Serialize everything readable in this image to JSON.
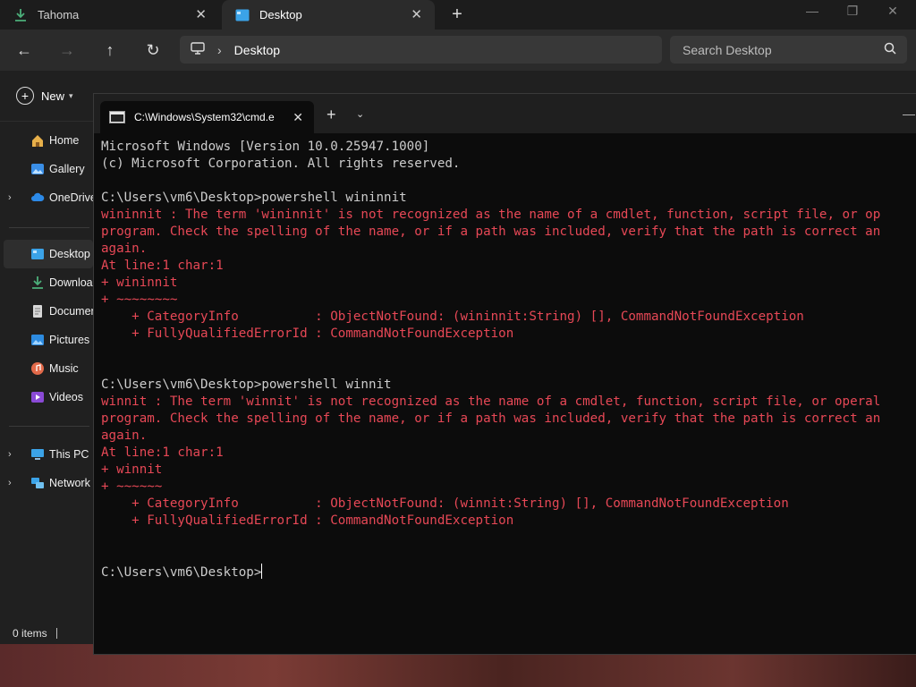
{
  "explorer": {
    "tabs": [
      {
        "label": "Tahoma",
        "icon": "download-icon",
        "active": false
      },
      {
        "label": "Desktop",
        "icon": "desktop-folder-icon",
        "active": true
      }
    ],
    "address": {
      "location": "Desktop"
    },
    "search": {
      "placeholder": "Search Desktop"
    },
    "command_bar": {
      "new_label": "New"
    },
    "sidebar": {
      "items": [
        {
          "label": "Home",
          "icon": "home-icon"
        },
        {
          "label": "Gallery",
          "icon": "gallery-icon"
        },
        {
          "label": "OneDrive",
          "icon": "cloud-icon"
        },
        {
          "label": "Desktop",
          "icon": "desktop-folder-icon"
        },
        {
          "label": "Downloads",
          "icon": "download-icon"
        },
        {
          "label": "Documents",
          "icon": "document-icon"
        },
        {
          "label": "Pictures",
          "icon": "pictures-icon"
        },
        {
          "label": "Music",
          "icon": "music-icon"
        },
        {
          "label": "Videos",
          "icon": "video-icon"
        },
        {
          "label": "This PC",
          "icon": "computer-icon"
        },
        {
          "label": "Network",
          "icon": "network-icon"
        }
      ]
    },
    "status": {
      "items_count": "0 items"
    }
  },
  "terminal": {
    "tab_title": "C:\\Windows\\System32\\cmd.e",
    "lines": [
      {
        "t": "Microsoft Windows [Version 10.0.25947.1000]",
        "c": "w"
      },
      {
        "t": "(c) Microsoft Corporation. All rights reserved.",
        "c": "w"
      },
      {
        "t": "",
        "c": "w"
      },
      {
        "t": "C:\\Users\\vm6\\Desktop>powershell wininnit",
        "c": "w"
      },
      {
        "t": "wininnit : The term 'wininnit' is not recognized as the name of a cmdlet, function, script file, or op",
        "c": "e"
      },
      {
        "t": "program. Check the spelling of the name, or if a path was included, verify that the path is correct an",
        "c": "e"
      },
      {
        "t": "again.",
        "c": "e"
      },
      {
        "t": "At line:1 char:1",
        "c": "e"
      },
      {
        "t": "+ wininnit",
        "c": "e"
      },
      {
        "t": "+ ~~~~~~~~",
        "c": "e"
      },
      {
        "t": "    + CategoryInfo          : ObjectNotFound: (wininnit:String) [], CommandNotFoundException",
        "c": "e"
      },
      {
        "t": "    + FullyQualifiedErrorId : CommandNotFoundException",
        "c": "e"
      },
      {
        "t": "",
        "c": "w"
      },
      {
        "t": "",
        "c": "w"
      },
      {
        "t": "C:\\Users\\vm6\\Desktop>powershell winnit",
        "c": "w"
      },
      {
        "t": "winnit : The term 'winnit' is not recognized as the name of a cmdlet, function, script file, or operal",
        "c": "e"
      },
      {
        "t": "program. Check the spelling of the name, or if a path was included, verify that the path is correct an",
        "c": "e"
      },
      {
        "t": "again.",
        "c": "e"
      },
      {
        "t": "At line:1 char:1",
        "c": "e"
      },
      {
        "t": "+ winnit",
        "c": "e"
      },
      {
        "t": "+ ~~~~~~",
        "c": "e"
      },
      {
        "t": "    + CategoryInfo          : ObjectNotFound: (winnit:String) [], CommandNotFoundException",
        "c": "e"
      },
      {
        "t": "    + FullyQualifiedErrorId : CommandNotFoundException",
        "c": "e"
      },
      {
        "t": "",
        "c": "w"
      },
      {
        "t": "",
        "c": "w"
      }
    ],
    "prompt": "C:\\Users\\vm6\\Desktop>",
    "colors": {
      "error": "#e74856",
      "normal": "#cccccc",
      "background": "#0c0c0c"
    }
  }
}
